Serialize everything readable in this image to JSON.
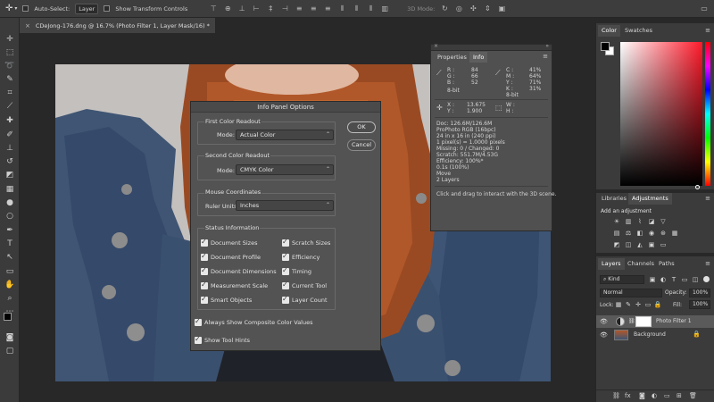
{
  "options_bar": {
    "auto_select_label": "Auto-Select:",
    "auto_select_value": "Layer",
    "show_transform_label": "Show Transform Controls",
    "mode_3d_label": "3D Mode:"
  },
  "document": {
    "tab_title": "CDeJong-176.dng @ 16.7% (Photo Filter 1, Layer Mask/16) *"
  },
  "info_panel_options": {
    "title": "Info Panel Options",
    "ok_label": "OK",
    "cancel_label": "Cancel",
    "first_readout": {
      "heading": "First Color Readout",
      "mode_label": "Mode:",
      "mode_value": "Actual Color"
    },
    "second_readout": {
      "heading": "Second Color Readout",
      "mode_label": "Mode:",
      "mode_value": "CMYK Color"
    },
    "mouse_coords": {
      "heading": "Mouse Coordinates",
      "units_label": "Ruler Units:",
      "units_value": "Inches"
    },
    "status_info": {
      "heading": "Status Information",
      "items": [
        {
          "label": "Document Sizes",
          "checked": true
        },
        {
          "label": "Scratch Sizes",
          "checked": true
        },
        {
          "label": "Document Profile",
          "checked": true
        },
        {
          "label": "Efficiency",
          "checked": true
        },
        {
          "label": "Document Dimensions",
          "checked": true
        },
        {
          "label": "Timing",
          "checked": true
        },
        {
          "label": "Measurement Scale",
          "checked": true
        },
        {
          "label": "Current Tool",
          "checked": true
        },
        {
          "label": "Smart Objects",
          "checked": true
        },
        {
          "label": "Layer Count",
          "checked": true
        }
      ]
    },
    "always_show_composite": "Always Show Composite Color Values",
    "show_tool_hints": "Show Tool Hints"
  },
  "info_panel": {
    "tab_properties": "Properties",
    "tab_info": "Info",
    "rgb": {
      "r_label": "R :",
      "r": "84",
      "g_label": "G :",
      "g": "66",
      "b_label": "B :",
      "b": "52",
      "bit": "8-bit"
    },
    "cmyk": {
      "c_label": "C :",
      "c": "41%",
      "m_label": "M :",
      "m": "64%",
      "y_label": "Y :",
      "y": "71%",
      "k_label": "K :",
      "k": "31%",
      "bit": "8-bit"
    },
    "xy": {
      "x_label": "X :",
      "x": "13.675",
      "y_label": "Y :",
      "y": "1.900"
    },
    "wh": {
      "w_label": "W :",
      "h_label": "H :"
    },
    "status_lines": [
      "Doc: 126.6M/126.6M",
      "ProPhoto RGB (16bpc)",
      "24 in x 16 in (240 ppi)",
      "1 pixel(s) = 1.0000 pixels",
      "Missing: 0 / Changed: 0",
      "Scratch: 551.7M/4.53G",
      "Efficiency: 100%*",
      "0.1s (100%)",
      "Move",
      "2 Layers"
    ],
    "hint": "Click and drag to interact with the 3D scene."
  },
  "right_panels": {
    "tab_color": "Color",
    "tab_swatches": "Swatches",
    "tab_libraries": "Libraries",
    "tab_adjustments": "Adjustments",
    "add_adjustment": "Add an adjustment",
    "tab_layers": "Layers",
    "tab_channels": "Channels",
    "tab_paths": "Paths",
    "kind_label": "Kind",
    "blend_mode": "Normal",
    "opacity_label": "Opacity:",
    "opacity_value": "100%",
    "lock_label": "Lock:",
    "fill_label": "Fill:",
    "fill_value": "100%",
    "layers": [
      {
        "name": "Photo Filter 1"
      },
      {
        "name": "Background"
      }
    ]
  },
  "colors": {
    "accent_hue_start": "#ffffff",
    "accent_hue_end": "#ff1a2a"
  }
}
